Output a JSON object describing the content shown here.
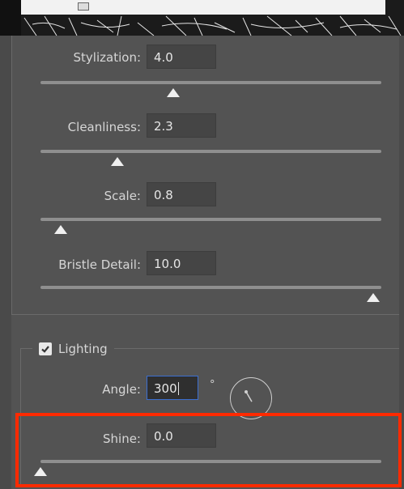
{
  "sliders": [
    {
      "label": "Stylization:",
      "value": "4.0",
      "fraction": 0.4
    },
    {
      "label": "Cleanliness:",
      "value": "2.3",
      "fraction": 0.23
    },
    {
      "label": "Scale:",
      "value": "0.8",
      "fraction": 0.06
    },
    {
      "label": "Bristle Detail:",
      "value": "10.0",
      "fraction": 1.0
    }
  ],
  "lighting": {
    "title": "Lighting",
    "checked": true,
    "angle_label": "Angle:",
    "angle_value": "300",
    "angle_unit": "°",
    "shine_label": "Shine:",
    "shine_value": "0.0",
    "shine_fraction": 0.0
  },
  "colors": {
    "panel_bg": "#535353",
    "field_bg": "#454545",
    "highlight": "#ff2a00",
    "focus": "#3b6fd1"
  }
}
